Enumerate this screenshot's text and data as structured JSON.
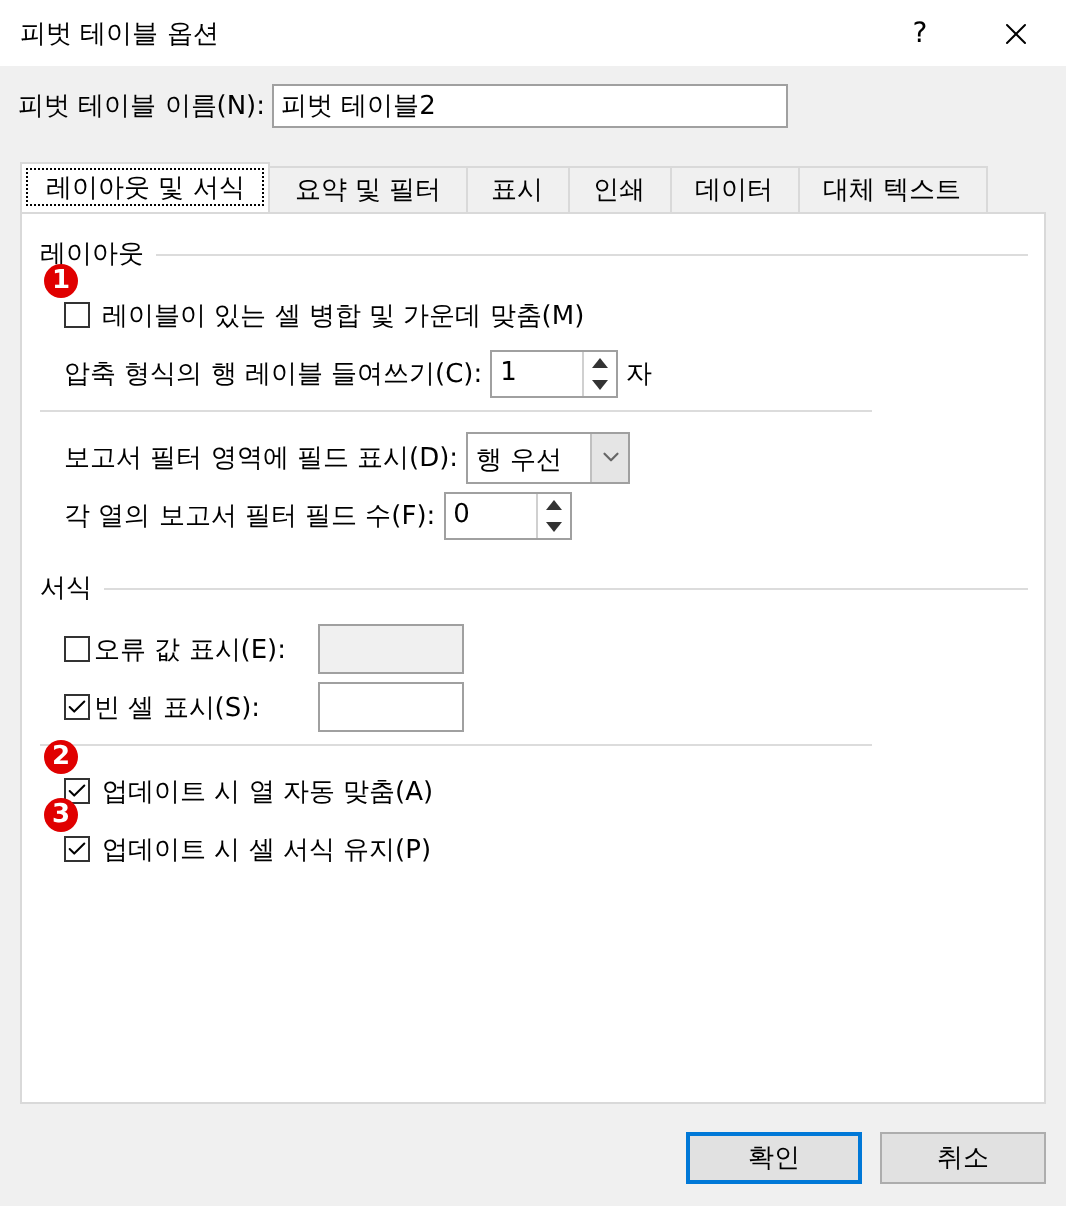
{
  "window": {
    "title": "피벗 테이블 옵션",
    "help": "?"
  },
  "name_field": {
    "label": "피벗 테이블 이름(N):",
    "value": "피벗 테이블2"
  },
  "tabs": [
    {
      "label": "레이아웃 및 서식",
      "selected": true
    },
    {
      "label": "요약 및 필터",
      "selected": false
    },
    {
      "label": "표시",
      "selected": false
    },
    {
      "label": "인쇄",
      "selected": false
    },
    {
      "label": "데이터",
      "selected": false
    },
    {
      "label": "대체 텍스트",
      "selected": false
    }
  ],
  "sections": [
    {
      "title": "레이아웃",
      "groups": [
        [
          {
            "kind": "checkbox",
            "label": "레이블이 있는 셀 병합 및 가운데 맞춤(M)",
            "checked": false,
            "badge": "1"
          },
          {
            "kind": "spinner",
            "label": "압축 형식의 행 레이블 들여쓰기(C):",
            "value": "1",
            "unit": "자"
          }
        ],
        [
          {
            "kind": "dropdown",
            "label": "보고서 필터 영역에 필드 표시(D):",
            "value": "행 우선"
          },
          {
            "kind": "spinner",
            "label": "각 열의 보고서 필터 필드 수(F):",
            "value": "0"
          }
        ]
      ]
    },
    {
      "title": "서식",
      "groups": [
        [
          {
            "kind": "checkfield",
            "label": "오류 값 표시(E):",
            "checked": false
          },
          {
            "kind": "checkfield",
            "label": "빈 셀 표시(S):",
            "checked": true
          }
        ],
        [
          {
            "kind": "checkbox",
            "label": "업데이트 시 열 자동 맞춤(A)",
            "checked": true,
            "badge": "2"
          },
          {
            "kind": "checkbox",
            "label": "업데이트 시 셀 서식 유지(P)",
            "checked": true,
            "badge": "3"
          }
        ]
      ]
    }
  ],
  "buttons": [
    {
      "label": "확인",
      "default": true
    },
    {
      "label": "취소",
      "default": false
    }
  ]
}
